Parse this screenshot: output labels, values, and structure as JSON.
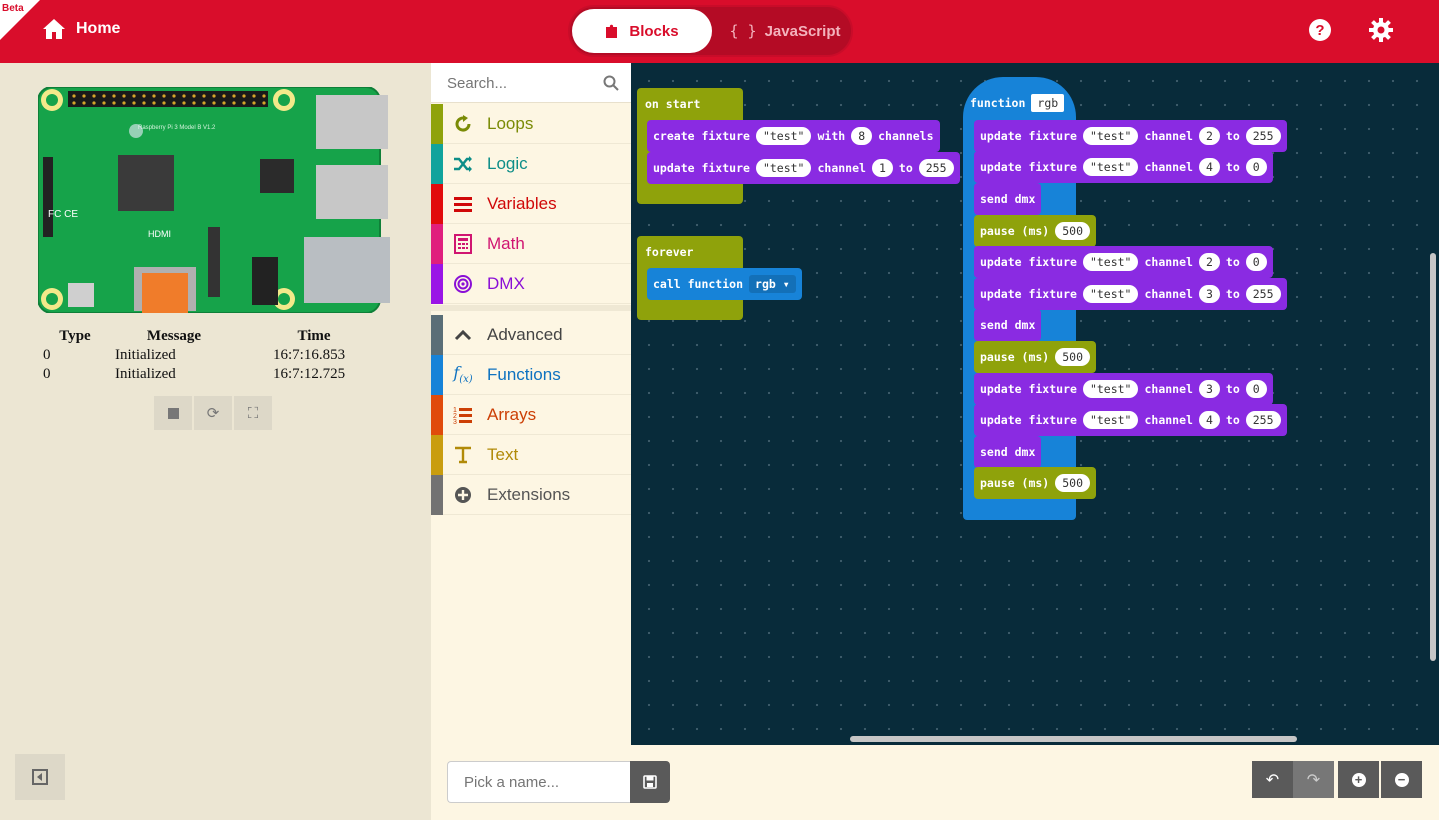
{
  "header": {
    "beta_label": "Beta",
    "home_label": "Home",
    "blocks_tab": "Blocks",
    "javascript_tab": "JavaScript"
  },
  "simulator": {
    "log_headers": [
      "Type",
      "Message",
      "Time"
    ],
    "log_rows": [
      {
        "type": "0",
        "message": "Initialized",
        "time": "16:7:16.853"
      },
      {
        "type": "0",
        "message": "Initialized",
        "time": "16:7:12.725"
      }
    ]
  },
  "toolbox": {
    "search_placeholder": "Search...",
    "categories": [
      {
        "label": "Loops",
        "color": "#8fa20b",
        "text_color": "#7a8b06",
        "icon": "loop-icon"
      },
      {
        "label": "Logic",
        "color": "#11a39c",
        "text_color": "#0e8e88",
        "icon": "shuffle-icon"
      },
      {
        "label": "Variables",
        "color": "#e10b0b",
        "text_color": "#d00808",
        "icon": "list-icon"
      },
      {
        "label": "Math",
        "color": "#e01f7d",
        "text_color": "#d01571",
        "icon": "calculator-icon"
      },
      {
        "label": "DMX",
        "color": "#9a15e6",
        "text_color": "#8a0fd6",
        "icon": "target-icon"
      }
    ],
    "advanced": [
      {
        "label": "Advanced",
        "color": "#5a6e77",
        "text_color": "#444",
        "icon": "chevron-up-icon"
      },
      {
        "label": "Functions",
        "color": "#1783d8",
        "text_color": "#0e72c0",
        "icon": "function-icon"
      },
      {
        "label": "Arrays",
        "color": "#e04b0b",
        "text_color": "#cc3f05",
        "icon": "numbered-list-icon"
      },
      {
        "label": "Text",
        "color": "#c99d0f",
        "text_color": "#b18a08",
        "icon": "text-icon"
      },
      {
        "label": "Extensions",
        "color": "#727272",
        "text_color": "#555",
        "icon": "plus-circle-icon"
      }
    ]
  },
  "workspace": {
    "on_start": {
      "label": "on start",
      "create": {
        "a": "create fixture",
        "name": "\"test\"",
        "b": "with",
        "n": "8",
        "c": "channels"
      },
      "update": {
        "a": "update fixture",
        "name": "\"test\"",
        "b": "channel",
        "ch": "1",
        "c": "to",
        "v": "255"
      }
    },
    "forever": {
      "label": "forever",
      "call": "call function",
      "fn": "rgb"
    },
    "function": {
      "label": "function",
      "name": "rgb",
      "lines": [
        {
          "kind": "update",
          "ch": "2",
          "v": "255"
        },
        {
          "kind": "update",
          "ch": "4",
          "v": "0"
        },
        {
          "kind": "send"
        },
        {
          "kind": "pause",
          "v": "500"
        },
        {
          "kind": "update",
          "ch": "2",
          "v": "0"
        },
        {
          "kind": "update",
          "ch": "3",
          "v": "255"
        },
        {
          "kind": "send"
        },
        {
          "kind": "pause",
          "v": "500"
        },
        {
          "kind": "update",
          "ch": "3",
          "v": "0"
        },
        {
          "kind": "update",
          "ch": "4",
          "v": "255"
        },
        {
          "kind": "send"
        },
        {
          "kind": "pause",
          "v": "500"
        }
      ],
      "update_label": "update fixture",
      "fixture": "\"test\"",
      "channel_label": "channel",
      "to_label": "to",
      "send_label": "send dmx",
      "pause_label": "pause (ms)"
    }
  },
  "bottom": {
    "name_placeholder": "Pick a name..."
  },
  "colors": {
    "header": "#d90d2b",
    "workspace": "#082b3a",
    "loops": "#8fa20b",
    "dmx": "#8a2be2",
    "functions": "#1783d8"
  }
}
